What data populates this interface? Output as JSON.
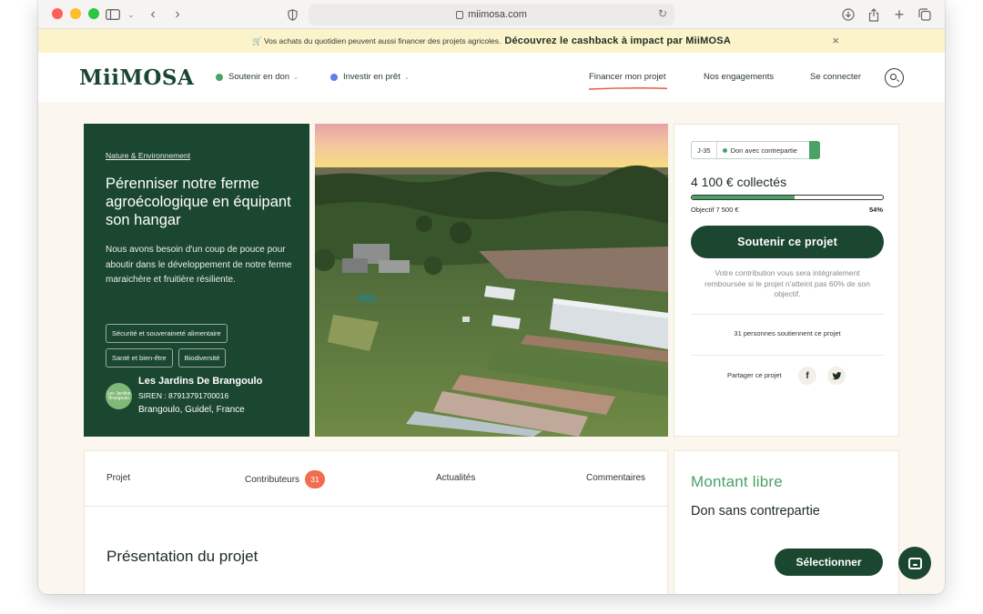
{
  "browser": {
    "url": "miimosa.com",
    "colors": {
      "close": "#ff5f57",
      "minimize": "#febc2e",
      "zoom": "#28c840"
    }
  },
  "promo": {
    "text": "🛒 Vos achats du quotidien peuvent aussi financer des projets agricoles.",
    "cta": "Découvrez le cashback à impact par MiiMOSA",
    "close_icon": "×"
  },
  "nav": {
    "logo": "MiiMOSA",
    "donate": "Soutenir en don",
    "invest": "Investir en prêt",
    "finance": "Financer mon projet",
    "engagements": "Nos engagements",
    "login": "Se connecter",
    "colors": {
      "donate": "#4aa266",
      "invest": "#5b82e8",
      "underline": "#e25c3c"
    }
  },
  "project": {
    "category": "Nature & Environnement",
    "title": "Pérenniser notre ferme agroécologique en équipant son hangar",
    "description": "Nous avons besoin d'un coup de pouce pour aboutir dans le développement de notre ferme maraichère et fruitière résiliente.",
    "tags": [
      "Sécurité et souveraineté alimentaire",
      "Santé et bien-être",
      "Biodiversité"
    ],
    "farm_logo_text": "Les Jardins Brangoulo",
    "farm_name": "Les Jardins De Brangoulo",
    "siren": "SIREN : 879137917000​16",
    "location": "Brangoulo, Guidel, France"
  },
  "funding": {
    "days_left": "J-35",
    "type": "Don avec contrepartie",
    "collected": "4 100 € collectés",
    "progress": 0.54,
    "objective": "Objectif 7 500 €",
    "percent": "54%",
    "support_button": "Soutenir ce projet",
    "note": "Votre contribution vous sera intégralement remboursée si le projet n'atteint pas 60% de son objectif.",
    "supporters": "31 personnes soutiennent ce projet",
    "share_label": "Partager ce projet",
    "facebook_icon": "f",
    "twitter_icon": "🐦"
  },
  "tabs": {
    "project": "Projet",
    "contributors": "Contributeurs",
    "contributors_count": "31",
    "news": "Actualités",
    "comments": "Commentaires"
  },
  "presentation": {
    "title": "Présentation du projet"
  },
  "reward": {
    "title": "Montant libre",
    "subtitle": "Don sans contrepartie",
    "button": "Sélectionner"
  },
  "colors": {
    "green_dark": "#1b4630",
    "green_accent": "#4aa266",
    "orange": "#f26d4f"
  }
}
